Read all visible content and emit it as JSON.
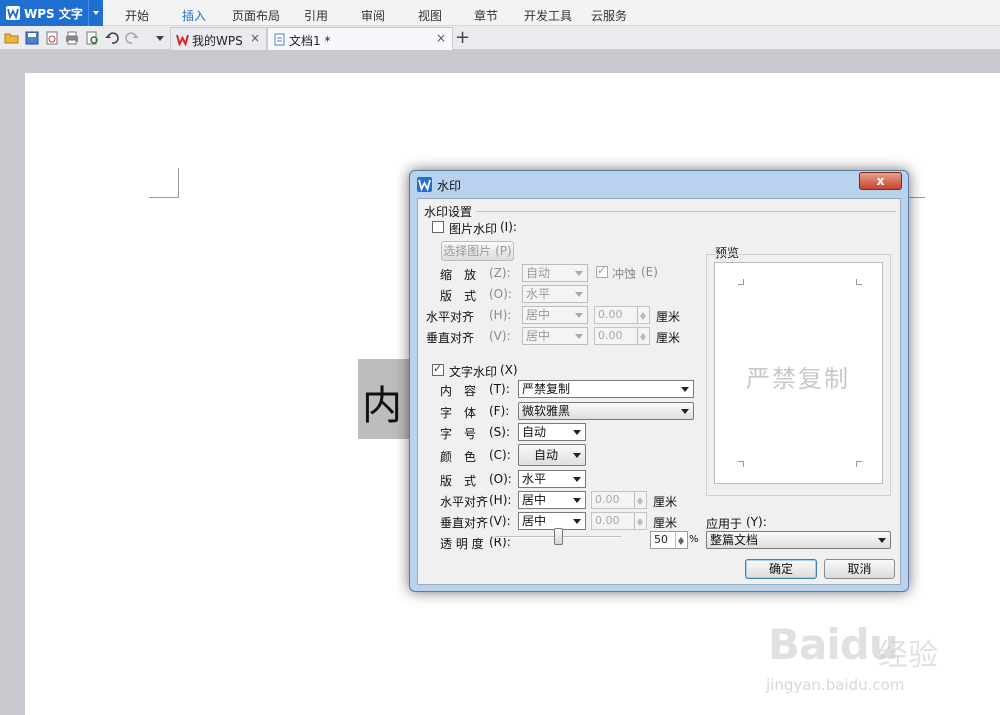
{
  "app": {
    "title": "WPS 文字"
  },
  "menu": [
    "开始",
    "插入",
    "页面布局",
    "引用",
    "审阅",
    "视图",
    "章节",
    "开发工具",
    "云服务"
  ],
  "tabs": [
    {
      "label": "我的WPS",
      "close": "×"
    },
    {
      "label": "文档1 *",
      "close": "×"
    }
  ],
  "new_tab": "+",
  "document": {
    "visible_char": "内"
  },
  "dialog": {
    "title": "水印",
    "close": "x",
    "section_title": "水印设置",
    "picture": {
      "checkbox_label": "图片水印",
      "checkbox_key": "(I):",
      "checked": false,
      "select_button": "选择图片",
      "select_key": "(P)",
      "scale_label": "缩　放",
      "scale_key": "(Z):",
      "scale_value": "自动",
      "washout_label": "冲蚀",
      "washout_key": "(E)",
      "washout_checked": true,
      "layout_label": "版　式",
      "layout_key": "(O):",
      "layout_value": "水平",
      "halign_label": "水平对齐",
      "halign_key": "(H):",
      "halign_value": "居中",
      "halign_num": "0.00",
      "valign_label": "垂直对齐",
      "valign_key": "(V):",
      "valign_value": "居中",
      "valign_num": "0.00",
      "unit": "厘米"
    },
    "text": {
      "checkbox_label": "文字水印",
      "checkbox_key": "(X)",
      "checked": true,
      "content_label": "内　容",
      "content_key": "(T):",
      "content_value": "严禁复制",
      "font_label": "字　体",
      "font_key": "(F):",
      "font_value": "微软雅黑",
      "size_label": "字　号",
      "size_key": "(S):",
      "size_value": "自动",
      "color_label": "颜　色",
      "color_key": "(C):",
      "color_value": "自动",
      "layout_label": "版　式",
      "layout_key": "(O):",
      "layout_value": "水平",
      "halign_label": "水平对齐",
      "halign_key": "(H):",
      "halign_value": "居中",
      "halign_num": "0.00",
      "valign_label": "垂直对齐",
      "valign_key": "(V):",
      "valign_value": "居中",
      "valign_num": "0.00",
      "unit": "厘米",
      "opacity_label": "透 明 度",
      "opacity_key": "(R):",
      "opacity_value": "50",
      "opacity_unit": "%",
      "opacity_level_percent": 50
    },
    "preview": {
      "label": "预览",
      "watermark_text": "严禁复制"
    },
    "apply": {
      "label": "应用于",
      "key": "(Y):",
      "value": "整篇文档"
    },
    "ok": "确定",
    "cancel": "取消"
  },
  "watermark": {
    "logo_text": "Bai",
    "logo_text2": "du",
    "logo_cn": "经验",
    "url": "jingyan.baidu.com"
  },
  "colors": {
    "accent": "#1f6fd1",
    "dialog_frame": "#b9d3ee",
    "close_button": "#c7442e"
  }
}
